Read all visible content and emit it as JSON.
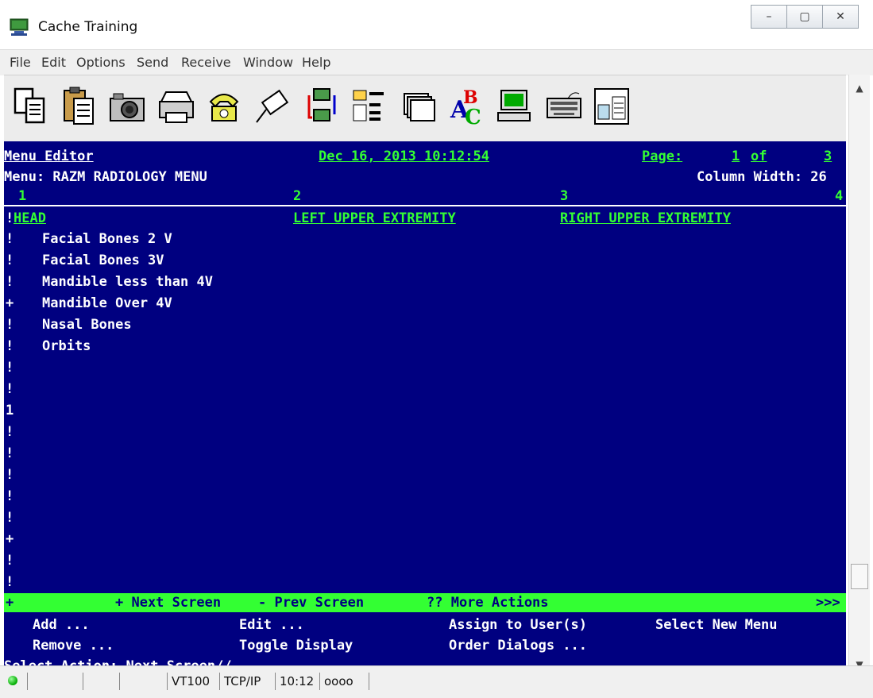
{
  "window": {
    "title": "Cache Training",
    "minimize": "–",
    "maximize": "▢",
    "close": "✕"
  },
  "menubar": [
    "File",
    "Edit",
    "Options",
    "Send",
    "Receive",
    "Window",
    "Help"
  ],
  "toolbar_icons": [
    "copy-icon",
    "paste-icon",
    "camera-icon",
    "print-icon",
    "phone-icon",
    "connect-icon",
    "network-icon",
    "file-manager-icon",
    "stack-icon",
    "spellcheck-icon",
    "computer-icon",
    "keyboard-icon",
    "window-icon"
  ],
  "terminal": {
    "app_name": "Menu Editor",
    "datetime": "Dec 16, 2013 10:12:54",
    "page_label": "Page:",
    "page_num": "1",
    "page_of": "of",
    "page_total": "3",
    "menu_line": "Menu: RAZM RADIOLOGY MENU",
    "column_width": "Column Width: 26",
    "col_nums": [
      "1",
      "2",
      "3",
      "4"
    ],
    "col_headers": [
      "HEAD",
      "LEFT UPPER EXTREMITY",
      "RIGHT UPPER EXTREMITY"
    ],
    "items": [
      "Facial Bones 2 V",
      "Facial Bones 3V",
      "Mandible less than 4V",
      "Mandible Over 4V",
      "Nasal Bones",
      "Orbits"
    ],
    "row_markers": [
      "!",
      "!",
      "!",
      "!",
      "+",
      "!",
      "!",
      "!",
      "!",
      "1",
      "!",
      "!",
      "!",
      "!",
      "!",
      "+",
      "!",
      "!"
    ],
    "nav": {
      "marker": "+",
      "next": "+ Next Screen",
      "prev": "- Prev Screen",
      "more": "?? More Actions",
      "arrows": ">>>"
    },
    "actions": {
      "add": "Add ...",
      "edit": "Edit ...",
      "assign": "Assign to User(s)",
      "select_new": "Select New Menu",
      "remove": "Remove ...",
      "toggle": "Toggle Display",
      "order": "Order Dialogs ..."
    },
    "prompt": "Select Action: Next Screen//"
  },
  "statusbar": {
    "vt": "VT100",
    "proto": "TCP/IP",
    "time": "10:12",
    "counter": "oooo"
  },
  "colors": {
    "terminal_bg": "#000080",
    "terminal_green": "#33ff33",
    "terminal_fg": "#ffffff"
  }
}
